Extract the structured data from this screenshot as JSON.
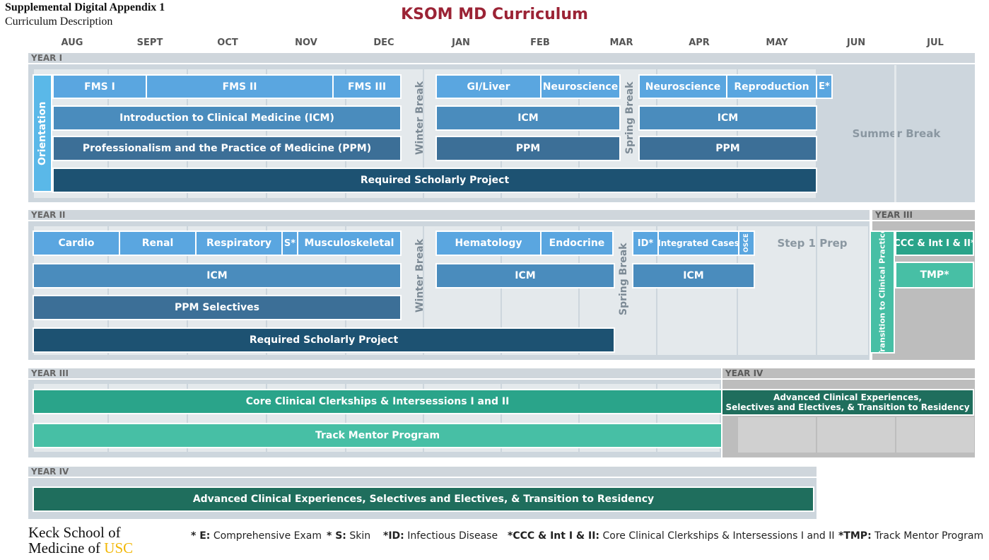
{
  "header": {
    "appendix": "Supplemental Digital Appendix 1",
    "description": "Curriculum Description",
    "title": "KSOM MD Curriculum"
  },
  "months": [
    "AUG",
    "SEPT",
    "OCT",
    "NOV",
    "DEC",
    "JAN",
    "FEB",
    "MAR",
    "APR",
    "MAY",
    "JUN",
    "JUL"
  ],
  "years": {
    "year1": "YEAR I",
    "year2": "YEAR II",
    "year3": "YEAR III",
    "year4": "YEAR IV"
  },
  "breaks": {
    "winter": "Winter Break",
    "spring": "Spring Break",
    "summer": "Summer Break",
    "step1": "Step 1 Prep"
  },
  "year1": {
    "orientation": "Orientation",
    "fms1": "FMS I",
    "fms2": "FMS II",
    "fms3": "FMS III",
    "icm_full": "Introduction to Clinical Medicine (ICM)",
    "ppm_full": "Professionalism and the Practice of Medicine (PPM)",
    "scholarly": "Required Scholarly Project",
    "gi": "GI/Liver",
    "neuro1": "Neuroscience",
    "icm": "ICM",
    "ppm": "PPM",
    "neuro2": "Neuroscience",
    "repro": "Reproduction",
    "exam": "E*"
  },
  "year2": {
    "cardio": "Cardio",
    "renal": "Renal",
    "resp": "Respiratory",
    "skin": "S*",
    "msk": "Musculoskeletal",
    "icm": "ICM",
    "ppm_sel": "PPM Selectives",
    "scholarly": "Required Scholarly Project",
    "heme": "Hematology",
    "endo": "Endocrine",
    "id": "ID*",
    "integrated": "Integrated Cases",
    "osce": "OSCE",
    "transition": "Transition to Clinical Practice",
    "ccc": "CCC & Int I & II*",
    "tmp": "TMP*"
  },
  "year3": {
    "core": "Core Clinical Clerkships & Intersessions I and II",
    "track": "Track Mentor Program",
    "ace_line1": "Advanced Clinical Experiences,",
    "ace_line2": "Selectives and Electives, & Transition to Residency"
  },
  "year4": {
    "ace": "Advanced Clinical Experiences, Selectives and Electives, & Transition to Residency"
  },
  "legend": {
    "e_key": "* E:",
    "e_val": "Comprehensive Exam",
    "s_key": "* S:",
    "s_val": "Skin",
    "id_key": "*ID:",
    "id_val": "Infectious Disease",
    "ccc_key": "*CCC & Int I & II:",
    "ccc_val": "Core Clinical Clerkships & Intersessions I and II",
    "tmp_key": "*TMP:",
    "tmp_val": "Track Mentor Program"
  },
  "logo": {
    "line1": "Keck School of",
    "line2": "Medicine of",
    "usc": "USC"
  },
  "colors": {
    "title": "#9b2335",
    "blue_light": "#5aa6e0",
    "blue_mid": "#4a8cbd",
    "blue_dark": "#3c6f97",
    "navy": "#1d5272",
    "teal_light": "#47bfa5",
    "teal_mid": "#2aa48a",
    "teal_dark": "#1f6e5d",
    "usc_gold": "#f2b705"
  }
}
